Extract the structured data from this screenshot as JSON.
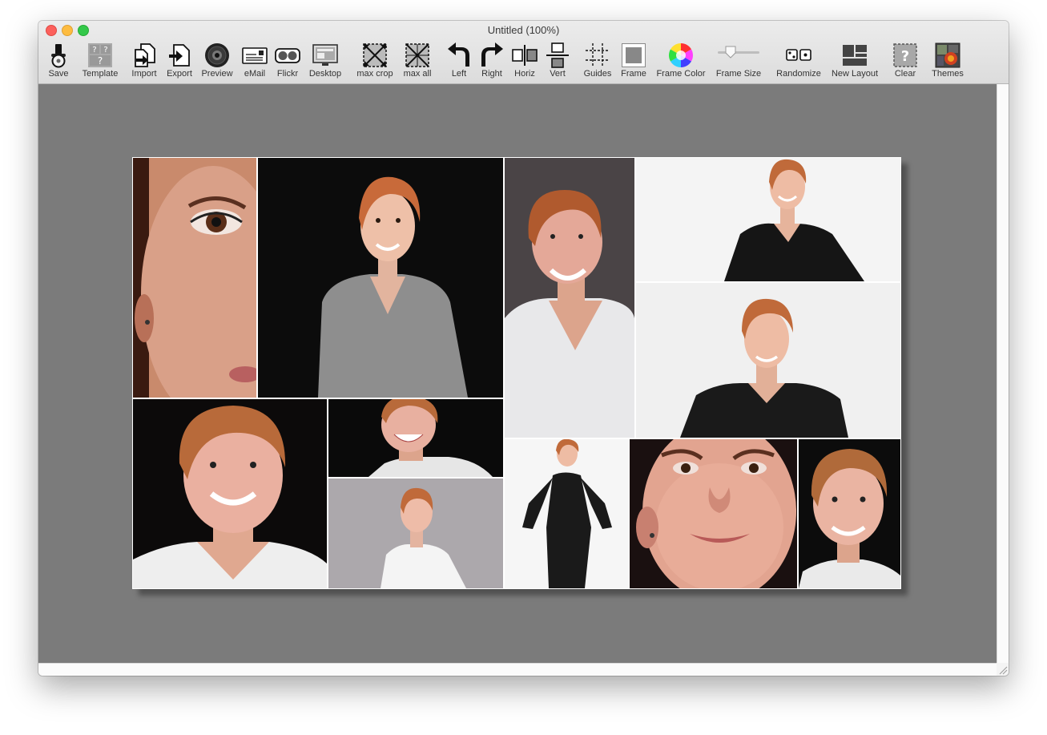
{
  "window": {
    "title": "Untitled (100%)"
  },
  "toolbar": [
    {
      "label": "Save",
      "icon": "save-icon"
    },
    {
      "label": "Template",
      "icon": "template-icon"
    },
    {
      "label": "Import",
      "icon": "import-icon"
    },
    {
      "label": "Export",
      "icon": "export-icon"
    },
    {
      "label": "Preview",
      "icon": "preview-icon"
    },
    {
      "label": "eMail",
      "icon": "email-icon"
    },
    {
      "label": "Flickr",
      "icon": "flickr-icon"
    },
    {
      "label": "Desktop",
      "icon": "desktop-icon"
    },
    {
      "label": "max crop",
      "icon": "max-crop-icon"
    },
    {
      "label": "max all",
      "icon": "max-all-icon"
    },
    {
      "label": "Left",
      "icon": "rotate-left-icon"
    },
    {
      "label": "Right",
      "icon": "rotate-right-icon"
    },
    {
      "label": "Horiz",
      "icon": "flip-horizontal-icon"
    },
    {
      "label": "Vert",
      "icon": "flip-vertical-icon"
    },
    {
      "label": "Guides",
      "icon": "guides-icon"
    },
    {
      "label": "Frame",
      "icon": "frame-icon"
    },
    {
      "label": "Frame Color",
      "icon": "color-wheel-icon"
    },
    {
      "label": "Frame Size",
      "icon": "frame-size-slider-icon"
    },
    {
      "label": "Randomize",
      "icon": "dice-icon"
    },
    {
      "label": "New Layout",
      "icon": "new-layout-icon"
    },
    {
      "label": "Clear",
      "icon": "clear-icon"
    },
    {
      "label": "Themes",
      "icon": "themes-icon"
    }
  ],
  "frame_size_level": 0.25,
  "colors": {
    "canvas": "#7b7b7b",
    "frame": "#ffffff",
    "close": "#fc605c",
    "minimize": "#fdbc40",
    "maximize": "#34c84a"
  },
  "collage_photos": [
    {
      "subject": "close-up-eye",
      "bg": "#c8876a"
    },
    {
      "subject": "woman-grey-top-black-background",
      "bg": "#0c0c0c"
    },
    {
      "subject": "woman-white-top-grey-background",
      "bg": "#4a4446"
    },
    {
      "subject": "woman-black-shirt-white-background-1",
      "bg": "#f4f4f4"
    },
    {
      "subject": "woman-black-shirt-white-background-2",
      "bg": "#f0f0f0"
    },
    {
      "subject": "woman-white-top-black-background",
      "bg": "#0c0a0a"
    },
    {
      "subject": "woman-laughing-black-background",
      "bg": "#0a0a0a"
    },
    {
      "subject": "woman-white-top-lavender-background",
      "bg": "#aca8ac"
    },
    {
      "subject": "woman-black-dress-full-body",
      "bg": "#f6f6f6"
    },
    {
      "subject": "face-close-up",
      "bg": "#1a1010"
    },
    {
      "subject": "woman-smiling-black-background",
      "bg": "#0c0c0c"
    }
  ]
}
